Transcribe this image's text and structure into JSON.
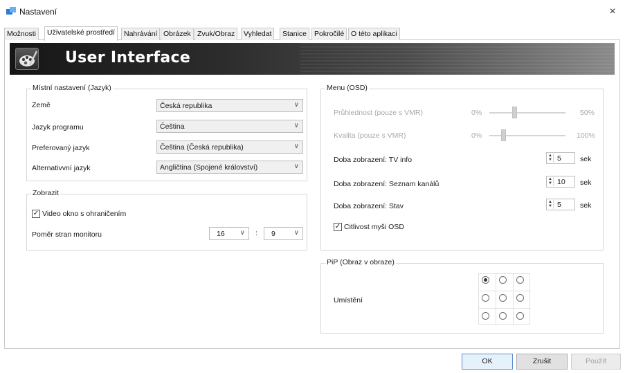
{
  "window": {
    "title": "Nastavení",
    "close_glyph": "×"
  },
  "tabs": [
    {
      "label": "Možnosti"
    },
    {
      "label": "Uživatelské prostředí"
    },
    {
      "label": "Nahrávání"
    },
    {
      "label": "Obrázek"
    },
    {
      "label": "Zvuk/Obraz"
    },
    {
      "label": "Vyhledat"
    },
    {
      "label": "Stanice"
    },
    {
      "label": "Pokročilé"
    },
    {
      "label": "O této aplikaci"
    }
  ],
  "active_tab": "Uživatelské prostředí",
  "banner": {
    "title": "User Interface",
    "icon": "palette-icon"
  },
  "locale_group": {
    "title": "Místní nastavení (Jazyk)",
    "rows": [
      {
        "label": "Země",
        "value": "Česká republika"
      },
      {
        "label": "Jazyk programu",
        "value": "Čeština"
      },
      {
        "label": "Preferovaný jazyk",
        "value": "Čeština (Česká republika)"
      },
      {
        "label": "Alternativvní jazyk",
        "value": "Angličtina (Spojené království)"
      }
    ]
  },
  "display_group": {
    "title": "Zobrazit",
    "video_border_label": "Video okno s ohraničením",
    "video_border_checked": true,
    "aspect_label": "Poměr stran monitoru",
    "aspect_w": "16",
    "aspect_sep": ":",
    "aspect_h": "9"
  },
  "osd_group": {
    "title": "Menu (OSD)",
    "transparency": {
      "label": "Průhlednost (pouze s VMR)",
      "min": "0%",
      "max": "50%",
      "level_fraction": 0.33
    },
    "quality": {
      "label": "Kvalita (pouze s VMR)",
      "min": "0%",
      "max": "100%",
      "level_fraction": 0.18
    },
    "durations": [
      {
        "label": "Doba zobrazení: TV info",
        "value": "5",
        "unit": "sek"
      },
      {
        "label": "Doba zobrazení: Seznam kanálů",
        "value": "10",
        "unit": "sek"
      },
      {
        "label": "Doba zobrazení: Stav",
        "value": "5",
        "unit": "sek"
      }
    ],
    "mouse_osd_label": "Citlivost myši OSD",
    "mouse_osd_checked": true
  },
  "pip_group": {
    "title": "PiP (Obraz v obraze)",
    "placement_label": "Umístění",
    "selected_position": "top-left"
  },
  "footer": {
    "ok": "OK",
    "cancel": "Zrušit",
    "apply": "Použít"
  },
  "colors": {
    "banner_dark": "#161616",
    "ok_border": "#5a8ad1"
  }
}
